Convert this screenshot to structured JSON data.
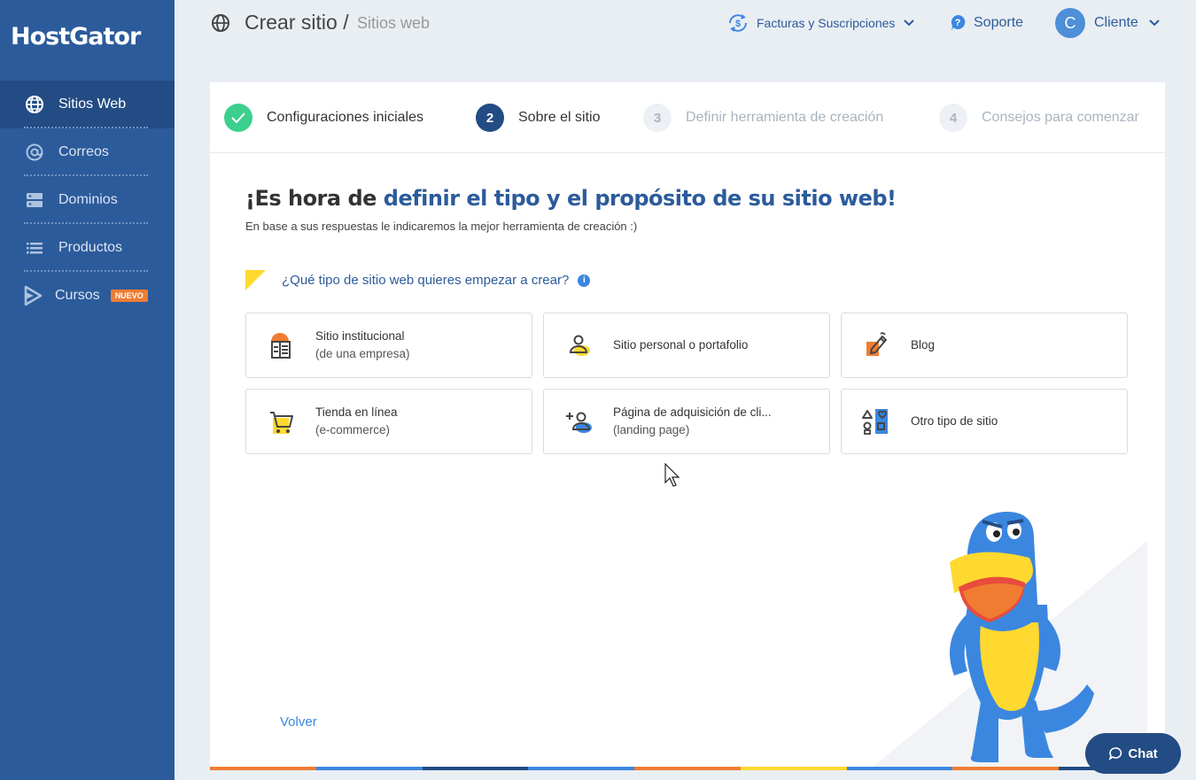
{
  "brand": {
    "logo": "HostGator"
  },
  "sidebar": {
    "items": [
      {
        "label": "Sitios Web",
        "icon": "globe-icon",
        "active": true
      },
      {
        "label": "Correos",
        "icon": "at-icon"
      },
      {
        "label": "Dominios",
        "icon": "server-icon"
      },
      {
        "label": "Productos",
        "icon": "list-icon"
      },
      {
        "label": "Cursos",
        "icon": "play-icon",
        "badge": "NUEVO"
      }
    ]
  },
  "header": {
    "title": "Crear sitio /",
    "subtitle": "Sitios web",
    "billing_label": "Facturas y Suscripciones",
    "support_label": "Soporte",
    "user_initial": "C",
    "user_label": "Cliente"
  },
  "steps": [
    {
      "number": "",
      "label": "Configuraciones iniciales",
      "state": "done"
    },
    {
      "number": "2",
      "label": "Sobre el sitio",
      "state": "current"
    },
    {
      "number": "3",
      "label": "Definir herramienta de creación",
      "state": "pending"
    },
    {
      "number": "4",
      "label": "Consejos para comenzar",
      "state": "pending"
    }
  ],
  "content": {
    "title_prefix": "¡Es hora de ",
    "title_highlight": "definir el tipo y el propósito de su sitio web!",
    "subtitle": "En base a sus respuestas le indicaremos la mejor herramienta de creación :)",
    "question": "¿Qué tipo de sitio web quieres empezar a crear?",
    "back_label": "Volver"
  },
  "options": [
    {
      "line1": "Sitio institucional",
      "line2": "(de una empresa)",
      "icon": "building-icon"
    },
    {
      "line1": "Sitio personal o portafolio",
      "line2": "",
      "icon": "person-icon"
    },
    {
      "line1": "Blog",
      "line2": "",
      "icon": "pencil-icon"
    },
    {
      "line1": "Tienda en línea",
      "line2": "(e-commerce)",
      "icon": "cart-icon"
    },
    {
      "line1": "Página de adquisición de cli...",
      "line2": "(landing page)",
      "icon": "add-person-icon"
    },
    {
      "line1": "Otro tipo de sitio",
      "line2": "",
      "icon": "shapes-icon"
    }
  ],
  "chat": {
    "label": "Chat"
  },
  "colors": {
    "sidebar": "#2c5b9b",
    "sidebar_active": "#234c84",
    "accent": "#2c5b9b",
    "link": "#3b87e0",
    "success": "#3ccf8e",
    "badge": "#f07c32",
    "yellow": "#ffd92f"
  }
}
